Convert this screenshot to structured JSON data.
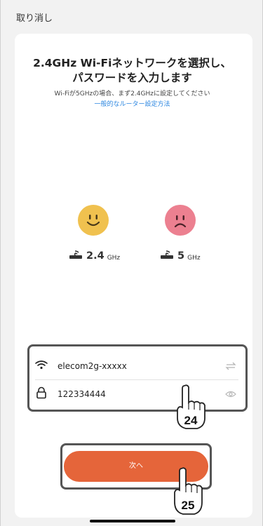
{
  "topbar": {
    "cancel_label": "取り消し"
  },
  "header": {
    "title_line1": "2.4GHz Wi-Fiネットワークを選択し、",
    "title_line2": "パスワードを入力します",
    "subtitle": "Wi-Fiが5GHzの場合、まず2.4GHzに設定してください",
    "link": "一般的なルーター設定方法"
  },
  "bands": [
    {
      "num": "2.4",
      "unit": "GHz",
      "status": "supported"
    },
    {
      "num": "5",
      "unit": "GHz",
      "status": "unsupported"
    }
  ],
  "form": {
    "ssid_value": "elecom2g-xxxxx",
    "password_value": "122334444"
  },
  "next_button": {
    "label": "次へ"
  },
  "annotations": {
    "step_a": "24",
    "step_b": "25"
  },
  "colors": {
    "accent": "#e5653a",
    "link": "#2b86e0",
    "happy_face": "#f0c14f",
    "sad_face": "#ec8090"
  },
  "icons": [
    "wifi-icon",
    "switch-arrows-icon",
    "lock-icon",
    "eye-icon",
    "router-icon",
    "happy-face-icon",
    "sad-face-icon",
    "pointing-hand-icon"
  ]
}
